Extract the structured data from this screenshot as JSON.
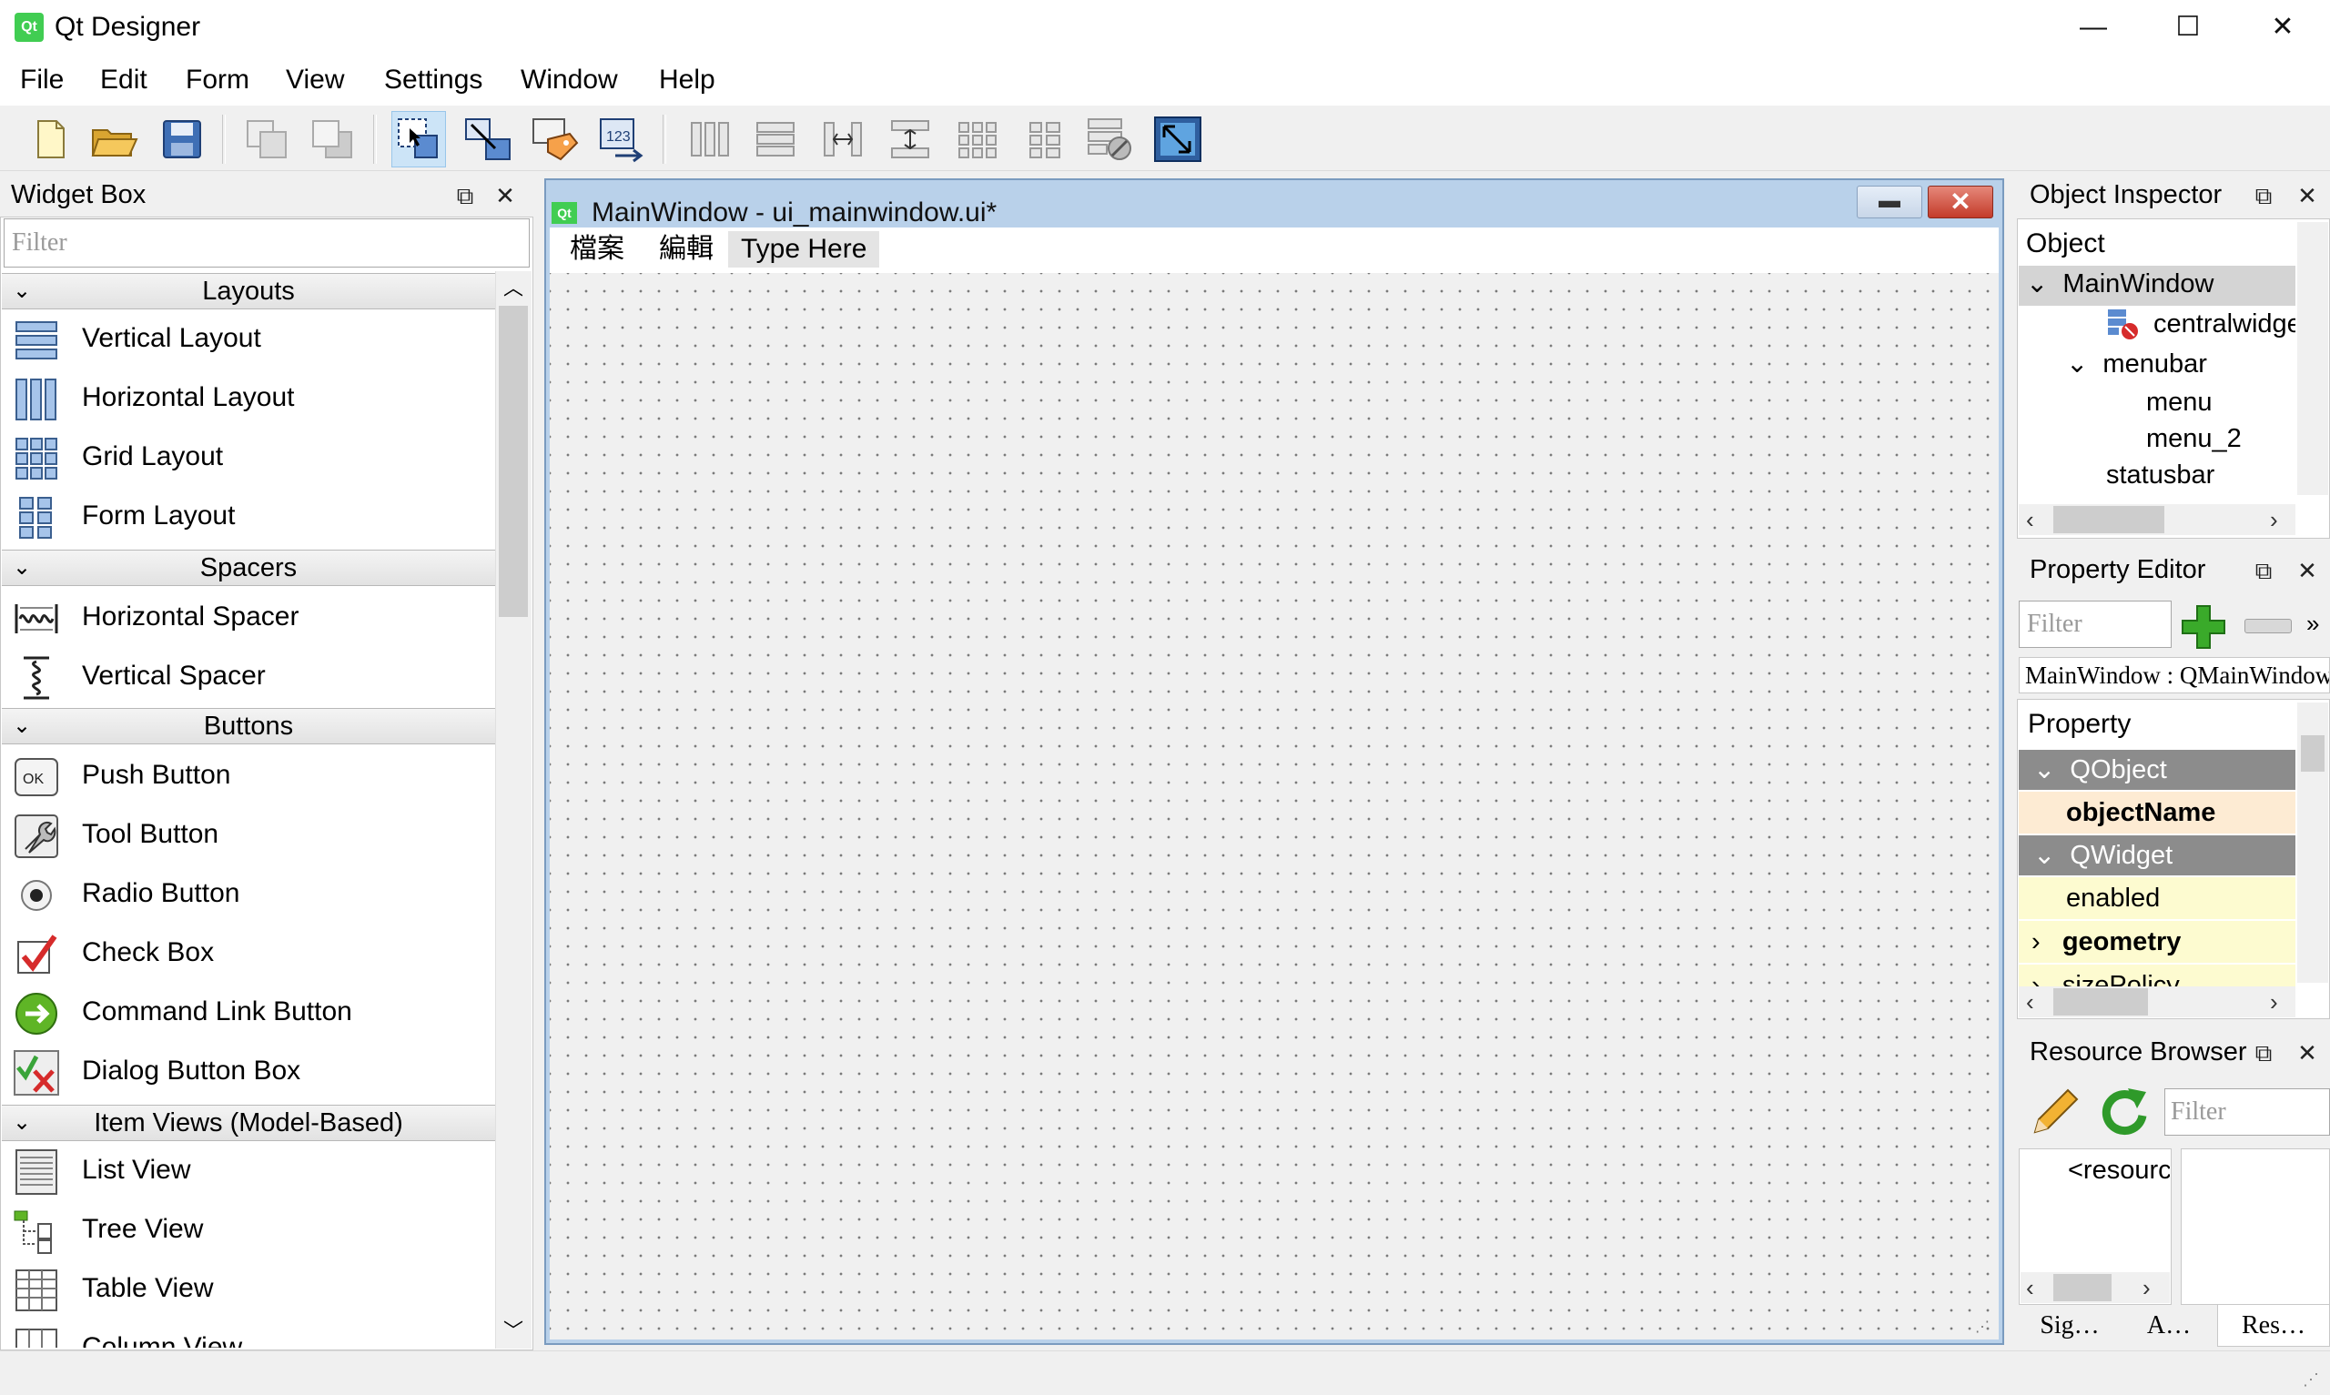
{
  "window": {
    "title": "Qt Designer",
    "icon_text": "Qt",
    "controls": {
      "minimize": "—",
      "maximize": "☐",
      "close": "✕"
    }
  },
  "menubar": [
    "File",
    "Edit",
    "Form",
    "View",
    "Settings",
    "Window",
    "Help"
  ],
  "toolbar": {
    "icons": [
      "new-file-icon",
      "open-folder-icon",
      "save-icon",
      "send-to-back-icon",
      "bring-to-front-icon",
      "edit-widgets-icon",
      "edit-signals-slots-icon",
      "edit-buddies-icon",
      "edit-tab-order-icon",
      "layout-horizontal-icon",
      "layout-vertical-icon",
      "layout-horizontal-splitter-icon",
      "layout-vertical-splitter-icon",
      "layout-grid-icon",
      "layout-form-icon",
      "break-layout-icon",
      "adjust-size-icon"
    ],
    "pressed": "edit-widgets-icon"
  },
  "widget_box": {
    "title": "Widget Box",
    "filter_placeholder": "Filter",
    "categories": [
      {
        "label": "Layouts",
        "items": [
          "Vertical Layout",
          "Horizontal Layout",
          "Grid Layout",
          "Form Layout"
        ]
      },
      {
        "label": "Spacers",
        "items": [
          "Horizontal Spacer",
          "Vertical Spacer"
        ]
      },
      {
        "label": "Buttons",
        "items": [
          "Push Button",
          "Tool Button",
          "Radio Button",
          "Check Box",
          "Command Link Button",
          "Dialog Button Box"
        ]
      },
      {
        "label": "Item Views (Model-Based)",
        "items": [
          "List View",
          "Tree View",
          "Table View",
          "Column View"
        ]
      }
    ]
  },
  "form_window": {
    "title": "MainWindow - ui_mainwindow.ui*",
    "icon_text": "Qt",
    "menus": [
      "檔案",
      "編輯",
      "Type Here"
    ]
  },
  "object_inspector": {
    "title": "Object Inspector",
    "header": "Object",
    "tree": [
      "MainWindow",
      "centralwidget",
      "menubar",
      "menu",
      "menu_2",
      "statusbar"
    ]
  },
  "property_editor": {
    "title": "Property Editor",
    "filter_placeholder": "Filter",
    "class_label": "MainWindow : QMainWindow",
    "header": "Property",
    "rows": [
      "QObject",
      "objectName",
      "QWidget",
      "enabled",
      "geometry",
      "sizePolicy"
    ],
    "row_colors": {
      "group": "#8c8c8c",
      "object_row": "#fdebd3",
      "widget_row": "#fdfbd0"
    }
  },
  "resource_browser": {
    "title": "Resource Browser",
    "filter_placeholder": "Filter",
    "root": "<resource root>"
  },
  "bottom_tabs": [
    "Sig…",
    "A…",
    "Res…"
  ],
  "colors": {
    "qt_green": "#41cd52",
    "toolbar_pressed": "#cce4f7",
    "mdi_frame": "#b9d1ea"
  }
}
